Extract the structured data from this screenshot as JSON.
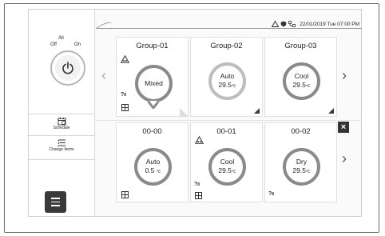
{
  "power": {
    "label_all": "All",
    "label_off": "Off",
    "label_on": "On"
  },
  "sidebar": {
    "schedule": "Schedule",
    "change_items": "Change Items"
  },
  "status_bar": {
    "datetime": "22/01/2019 Tue 07:00 PM"
  },
  "groups": [
    {
      "name": "Group-01",
      "mode": "Mixed",
      "temp": "",
      "unit": ""
    },
    {
      "name": "Group-02",
      "mode": "Auto",
      "temp": "29.5",
      "unit": "℃"
    },
    {
      "name": "Group-03",
      "mode": "Cool",
      "temp": "29.5",
      "unit": "℃"
    }
  ],
  "units": [
    {
      "name": "00-00",
      "mode": "Auto",
      "temp": "0.5",
      "unit": "℃"
    },
    {
      "name": "00-01",
      "mode": "Cool",
      "temp": "29.5",
      "unit": "℃"
    },
    {
      "name": "00-02",
      "mode": "Dry",
      "temp": "29.5",
      "unit": "℃"
    }
  ],
  "icons": {
    "close": "×",
    "chevron_left": "‹",
    "chevron_right": "›"
  }
}
